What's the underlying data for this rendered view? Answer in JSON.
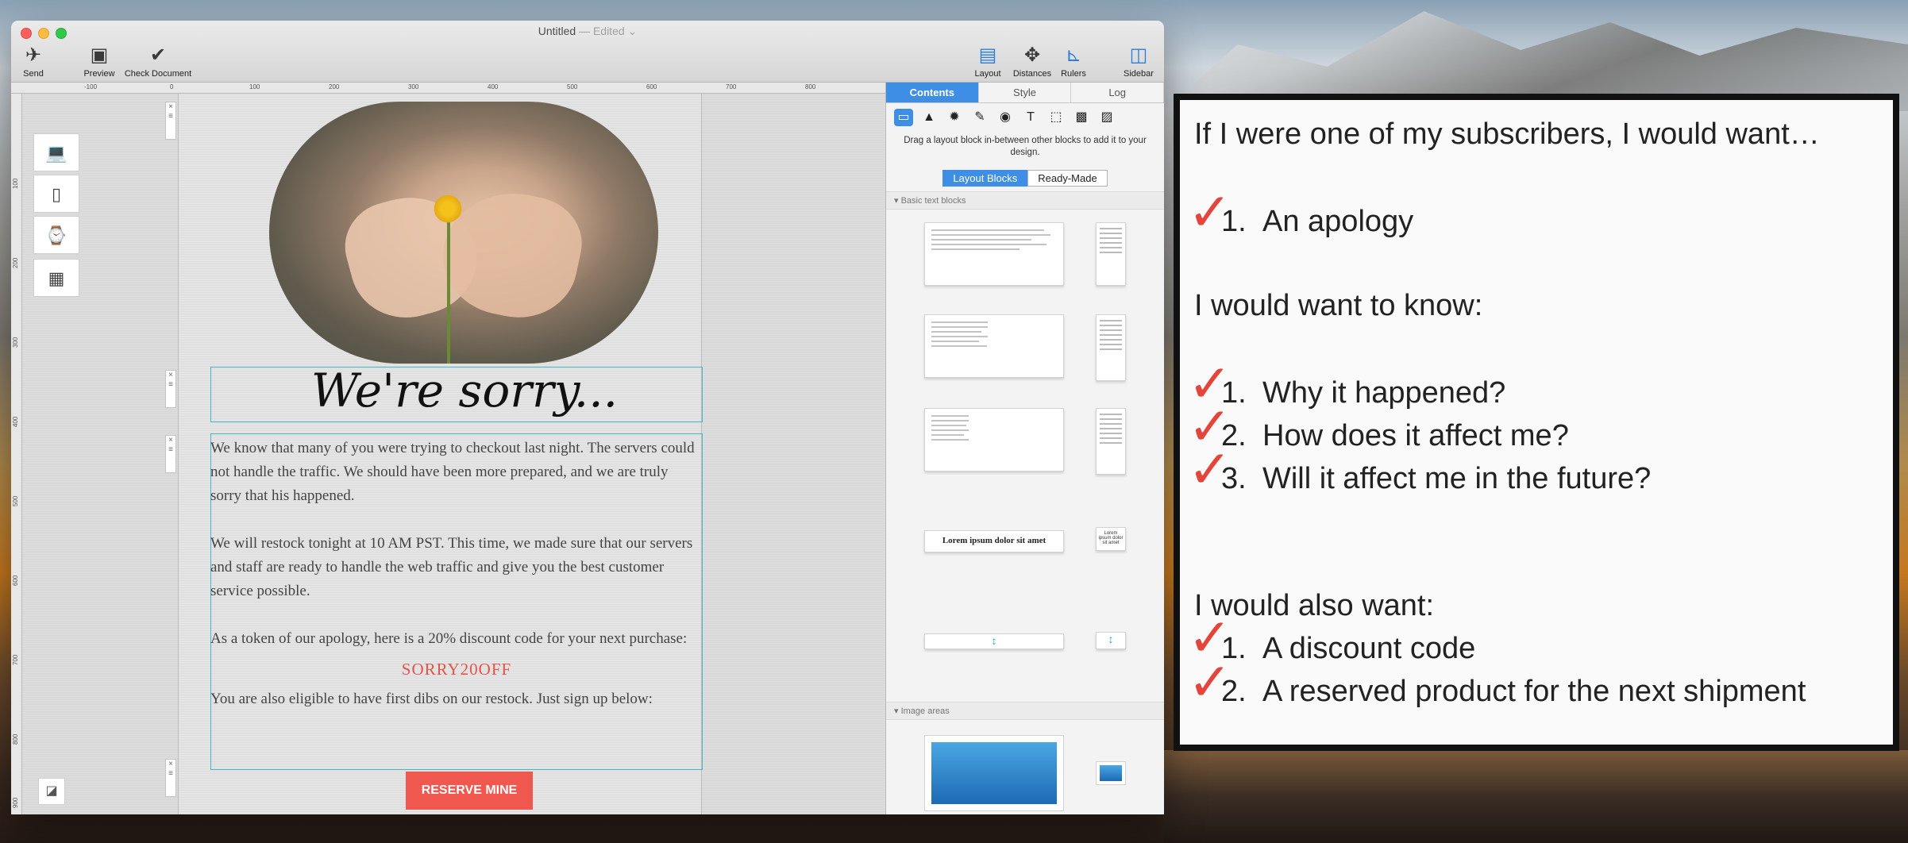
{
  "window": {
    "title": "Untitled",
    "edited": "— Edited ⌄"
  },
  "toolbar": {
    "send": "Send",
    "preview": "Preview",
    "check_document": "Check Document",
    "layout": "Layout",
    "distances": "Distances",
    "rulers": "Rulers",
    "sidebar": "Sidebar"
  },
  "ruler_top": [
    "-100",
    "0",
    "100",
    "200",
    "300",
    "400",
    "500",
    "600",
    "700",
    "800"
  ],
  "ruler_left": [
    "100",
    "200",
    "300",
    "400",
    "500",
    "600",
    "700",
    "800",
    "900"
  ],
  "email": {
    "headline": "We're sorry...",
    "paragraph1": "We know that many of you were trying to checkout last night. The servers could not handle the traffic. We should have been more prepared, and we are truly sorry that his happened.",
    "paragraph2": "We will restock tonight at 10 AM PST.  This time, we made sure that our servers and staff are ready to handle the web traffic and give you the best customer service possible.",
    "paragraph3": "As a token of our apology, here is a 20% discount code for your next purchase:",
    "discount_code": "SORRY20OFF",
    "paragraph4": "You are also eligible to have first dibs on our restock. Just sign up below:",
    "cta": "RESERVE MINE"
  },
  "sidebar": {
    "tabs": [
      "Contents",
      "Style",
      "Log"
    ],
    "active_tab": "Contents",
    "hint": "Drag a layout block in-between other blocks to add it to your design.",
    "segments": [
      "Layout Blocks",
      "Ready-Made"
    ],
    "section_text": "Basic text blocks",
    "section_image": "Image areas",
    "lorem": "Lorem ipsum dolor sit amet",
    "lorem_mini": "Lorem ipsum dolor sit amet"
  },
  "note": {
    "intro": "If I were one of my subscribers, I would want…",
    "item_apology_num": "1.",
    "item_apology": "An apology",
    "know_heading": "I would want to know:",
    "know_items": [
      {
        "num": "1.",
        "text": "Why it happened?"
      },
      {
        "num": "2.",
        "text": "How does it affect me?"
      },
      {
        "num": "3.",
        "text": "Will it affect me in the future?"
      }
    ],
    "also_heading": "I would also want:",
    "also_items": [
      {
        "num": "1.",
        "text": "A discount code"
      },
      {
        "num": "2.",
        "text": "A reserved product for the next shipment"
      }
    ]
  },
  "colors": {
    "accent": "#3d8ee4",
    "cta": "#f0584f",
    "discount": "#e5544a",
    "check": "#e5443b"
  },
  "icons": {
    "send": "paper-plane-icon",
    "preview": "devices-icon",
    "check": "checkmark-circle-icon",
    "layout": "layout-icon",
    "distances": "move-arrows-icon",
    "rulers": "ruler-icon",
    "sidebar": "sidebar-icon"
  }
}
